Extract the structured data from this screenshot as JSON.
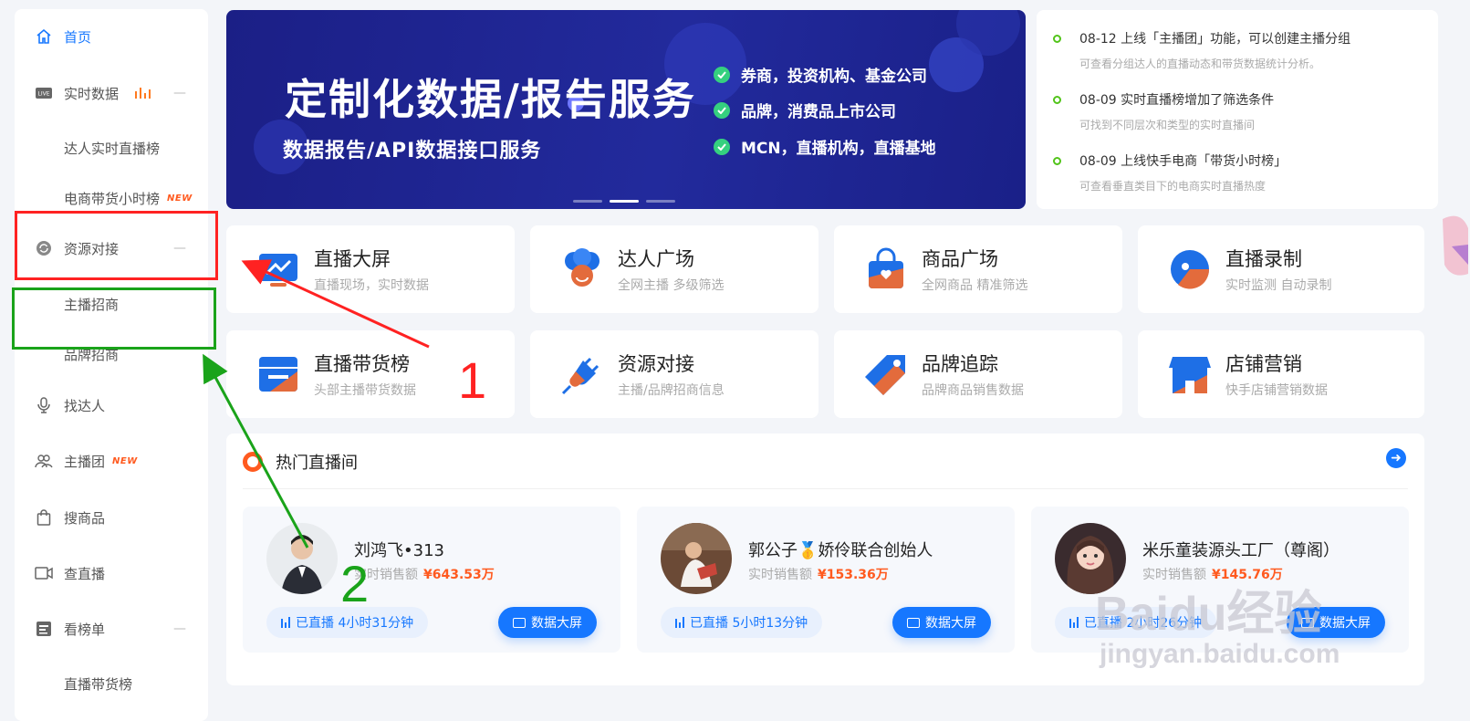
{
  "sidebar": {
    "items": [
      {
        "label": "首页",
        "icon": "home-icon"
      },
      {
        "label": "实时数据",
        "icon": "live-icon"
      },
      {
        "label": "达人实时直播榜"
      },
      {
        "label": "电商带货小时榜",
        "badge": "NEW"
      },
      {
        "label": "资源对接",
        "icon": "refresh-icon"
      },
      {
        "label": "主播招商"
      },
      {
        "label": "品牌招商"
      },
      {
        "label": "找达人",
        "icon": "microphone-icon"
      },
      {
        "label": "主播团",
        "icon": "group-icon",
        "badge": "NEW"
      },
      {
        "label": "搜商品",
        "icon": "bag-icon"
      },
      {
        "label": "查直播",
        "icon": "video-icon"
      },
      {
        "label": "看榜单",
        "icon": "list-icon"
      },
      {
        "label": "直播带货榜"
      }
    ],
    "collapse_mark": "—"
  },
  "banner": {
    "title": "定制化数据/报告服务",
    "subtitle": "数据报告/API数据接口服务",
    "points": [
      "券商，投资机构、基金公司",
      "品牌，消费品上市公司",
      "MCN，直播机构，直播基地"
    ]
  },
  "news": [
    {
      "title": "08-12 上线「主播团」功能，可以创建主播分组",
      "desc": "可查看分组达人的直播动态和带货数据统计分析。"
    },
    {
      "title": "08-09 实时直播榜增加了筛选条件",
      "desc": "可找到不同层次和类型的实时直播间"
    },
    {
      "title": "08-09 上线快手电商「带货小时榜」",
      "desc": "可查看垂直类目下的电商实时直播热度"
    }
  ],
  "features": [
    {
      "title": "直播大屏",
      "desc": "直播现场，实时数据",
      "icon": "screen-icon"
    },
    {
      "title": "达人广场",
      "desc": "全网主播 多级筛选",
      "icon": "influencer-icon"
    },
    {
      "title": "商品广场",
      "desc": "全网商品 精准筛选",
      "icon": "shopping-bag-icon"
    },
    {
      "title": "直播录制",
      "desc": "实时监测 自动录制",
      "icon": "record-icon"
    },
    {
      "title": "直播带货榜",
      "desc": "头部主播带货数据",
      "icon": "ranking-icon"
    },
    {
      "title": "资源对接",
      "desc": "主播/品牌招商信息",
      "icon": "plug-icon"
    },
    {
      "title": "品牌追踪",
      "desc": "品牌商品销售数据",
      "icon": "tag-icon"
    },
    {
      "title": "店铺营销",
      "desc": "快手店铺营销数据",
      "icon": "store-icon"
    }
  ],
  "hot": {
    "title": "热门直播间",
    "more_icon": "arrow-right-icon",
    "rooms": [
      {
        "name": "刘鸿飞•313",
        "sales_label": "实时销售额",
        "sales": "¥643.53万",
        "live_label": "已直播",
        "duration": "4小时31分钟",
        "button": "数据大屏"
      },
      {
        "name": "郭公子🥇娇伶联合创始人",
        "sales_label": "实时销售额",
        "sales": "¥153.36万",
        "live_label": "已直播",
        "duration": "5小时13分钟",
        "button": "数据大屏"
      },
      {
        "name": "米乐童装源头工厂（尊阁）",
        "sales_label": "实时销售额",
        "sales": "¥145.76万",
        "live_label": "已直播",
        "duration": "2小时26分钟",
        "button": "数据大屏"
      }
    ]
  },
  "annotations": {
    "label_1": "1",
    "label_2": "2",
    "red": "#ff2222",
    "green": "#1aa31a"
  },
  "watermark": {
    "brand": "Baidu经验",
    "url": "jingyan.baidu.com"
  },
  "colors": {
    "accent": "#1677ff",
    "price": "#ff5a1f",
    "banner": "#1f2592",
    "new_badge": "#ff5a1f"
  }
}
